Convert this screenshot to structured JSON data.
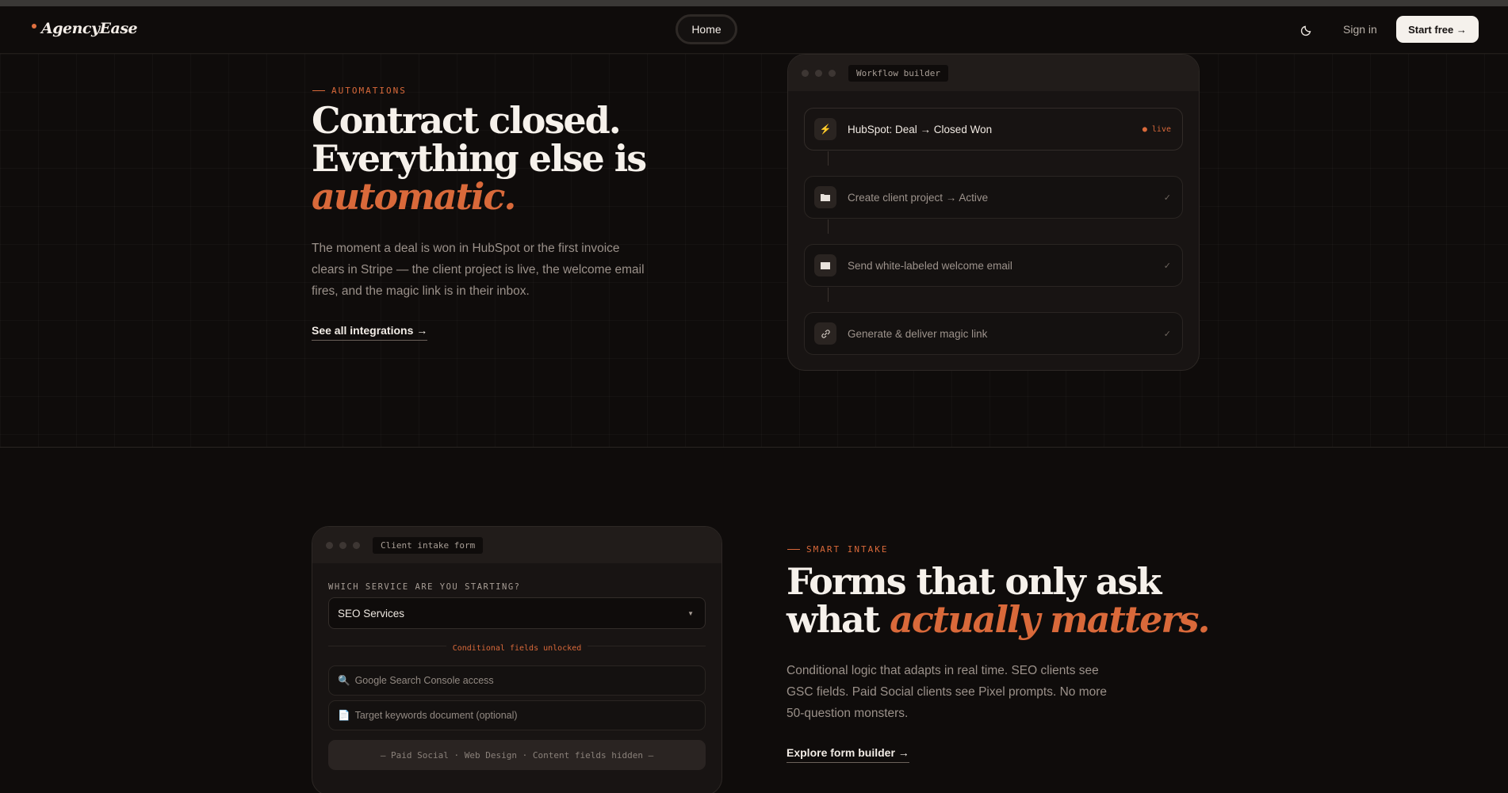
{
  "nav": {
    "logo": "AgencyEase",
    "home": "Home",
    "sign_in": "Sign in",
    "start_free": "Start free →"
  },
  "automations": {
    "eyebrow": "AUTOMATIONS",
    "headline_line1": "Contract closed.",
    "headline_line2": "Everything else is",
    "headline_accent": "automatic.",
    "body": "The moment a deal is won in HubSpot or the first invoice clears in Stripe — the client project is live, the welcome email fires, and the magic link is in their inbox.",
    "cta": "See all integrations →",
    "window_tag": "Workflow builder",
    "steps": [
      {
        "label": "HubSpot: Deal → Closed Won",
        "end": "● live"
      },
      {
        "label": "Create client project → Active",
        "end": "✓"
      },
      {
        "label": "Send white-labeled welcome email",
        "end": "✓"
      },
      {
        "label": "Generate & deliver magic link",
        "end": "✓"
      }
    ]
  },
  "intake": {
    "eyebrow": "SMART INTAKE",
    "headline_line1": "Forms that only ask",
    "headline_line2_plain": "what ",
    "headline_accent": "actually matters.",
    "body": "Conditional logic that adapts in real time. SEO clients see GSC fields. Paid Social clients see Pixel prompts. No more 50-question monsters.",
    "cta": "Explore form builder →",
    "window_tag": "Client intake form",
    "question": "WHICH SERVICE ARE YOU STARTING?",
    "selected": "SEO Services",
    "unlocked": "Conditional fields unlocked",
    "fields": [
      {
        "icon": "🔍",
        "label": "Google Search Console access"
      },
      {
        "icon": "📄",
        "label": "Target keywords document (optional)"
      }
    ],
    "hidden_note": "— Paid Social · Web Design · Content fields hidden —"
  },
  "colors": {
    "accent": "#d9693a",
    "background": "#0f0c0b",
    "button_bg": "#f5f1ec"
  }
}
